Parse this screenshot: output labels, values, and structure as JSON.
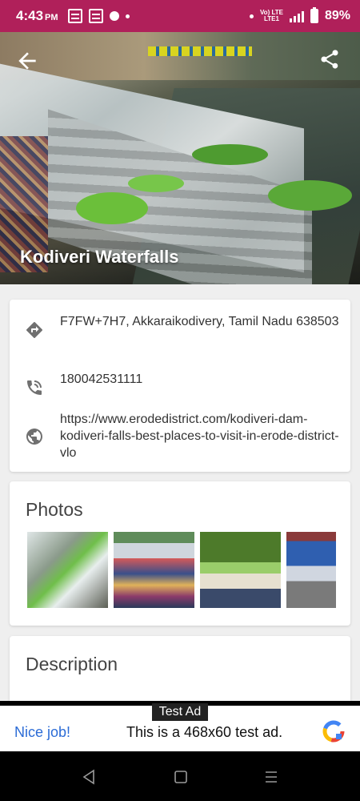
{
  "status_bar": {
    "time": "4:43",
    "ampm": "PM",
    "network_label_top": "Vo) LTE",
    "network_label_bottom": "LTE1",
    "battery": "89%"
  },
  "hero": {
    "title": "Kodiveri Waterfalls",
    "back_icon": "arrow-back-icon",
    "share_icon": "share-icon"
  },
  "info": {
    "address": "F7FW+7H7, Akkaraikodivery, Tamil Nadu 638503",
    "phone": "180042531111",
    "website": "https://www.erodedistrict.com/kodiveri-dam-kodiveri-falls-best-places-to-visit-in-erode-district-vlo"
  },
  "photos": {
    "heading": "Photos"
  },
  "description": {
    "heading": "Description"
  },
  "ad": {
    "tag": "Test Ad",
    "cta": "Nice job!",
    "message": "This is a 468x60 test ad."
  },
  "colors": {
    "status_bar": "#b0205a",
    "link_blue": "#2c6cd6",
    "card_bg": "#ffffff",
    "content_bg": "#efefef"
  }
}
